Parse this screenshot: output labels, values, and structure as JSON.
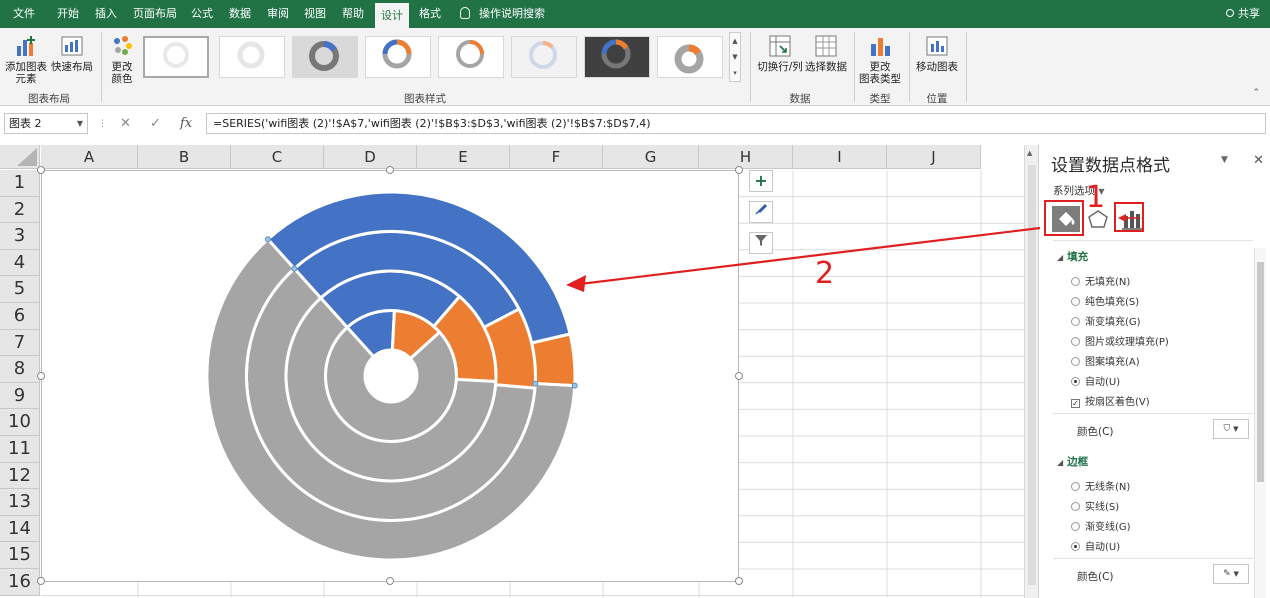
{
  "ribbon_tabs": [
    {
      "label": "文件",
      "active": false
    },
    {
      "label": "开始",
      "active": false
    },
    {
      "label": "插入",
      "active": false
    },
    {
      "label": "页面布局",
      "active": false
    },
    {
      "label": "公式",
      "active": false
    },
    {
      "label": "数据",
      "active": false
    },
    {
      "label": "审阅",
      "active": false
    },
    {
      "label": "视图",
      "active": false
    },
    {
      "label": "帮助",
      "active": false
    },
    {
      "label": "设计",
      "active": true
    },
    {
      "label": "格式",
      "active": false
    }
  ],
  "tell_me": "操作说明搜索",
  "share": "共享",
  "ribbon": {
    "add_element": "添加图表\n元素",
    "quick_layout": "快速布局",
    "change_colors": "更改\n颜色",
    "group_layout": "图表布局",
    "group_styles": "图表样式",
    "switch_row_col": "切换行/列",
    "select_data": "选择数据",
    "group_data": "数据",
    "change_type": "更改\n图表类型",
    "group_type": "类型",
    "move_chart": "移动图表",
    "group_location": "位置"
  },
  "formula_bar": {
    "name_box": "图表 2",
    "fx": "fx",
    "formula": "=SERIES('wifi图表 (2)'!$A$7,'wifi图表 (2)'!$B$3:$D$3,'wifi图表 (2)'!$B$7:$D$7,4)"
  },
  "columns": [
    "A",
    "B",
    "C",
    "D",
    "E",
    "F",
    "G",
    "H",
    "I",
    "J"
  ],
  "rows": [
    "1",
    "2",
    "3",
    "4",
    "5",
    "6",
    "7",
    "8",
    "9",
    "10",
    "11",
    "12",
    "13",
    "14",
    "15",
    "16"
  ],
  "chart_data": {
    "type": "doughnut",
    "rings": [
      {
        "ring": 1,
        "values": [
          0.125,
          0.125,
          0.75
        ]
      },
      {
        "ring": 2,
        "values": [
          0.23,
          0.145,
          0.625
        ]
      },
      {
        "ring": 3,
        "values": [
          0.29,
          0.09,
          0.62
        ]
      },
      {
        "ring": 4,
        "values": [
          0.33,
          0.045,
          0.625
        ]
      }
    ],
    "colors": [
      "#4472C4",
      "#ED7D31",
      "#A5A5A5"
    ]
  },
  "pane": {
    "title": "设置数据点格式",
    "series_options": "系列选项",
    "fill_header": "填充",
    "fill_options": [
      {
        "label": "无填充(N)",
        "checked": false
      },
      {
        "label": "纯色填充(S)",
        "checked": false
      },
      {
        "label": "渐变填充(G)",
        "checked": false
      },
      {
        "label": "图片或纹理填充(P)",
        "checked": false
      },
      {
        "label": "图案填充(A)",
        "checked": false
      },
      {
        "label": "自动(U)",
        "checked": true
      }
    ],
    "vary_by_point": "按扇区着色(V)",
    "color_label": "颜色(C)",
    "border_header": "边框",
    "border_options": [
      {
        "label": "无线条(N)",
        "checked": false
      },
      {
        "label": "实线(S)",
        "checked": false
      },
      {
        "label": "渐变线(G)",
        "checked": false
      },
      {
        "label": "自动(U)",
        "checked": true
      }
    ],
    "border_color_label": "颜色(C)"
  },
  "annotations": {
    "label_1": "1",
    "label_2": "2",
    "color": "#E02020"
  }
}
